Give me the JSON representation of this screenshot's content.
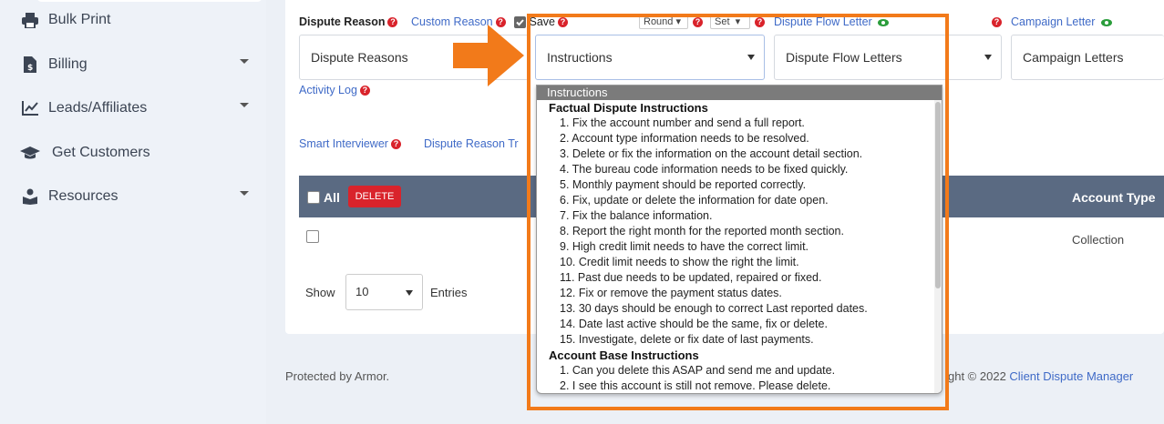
{
  "sidebar": {
    "items": [
      {
        "label": "Bulk Print",
        "icon": "printer-icon",
        "has_caret": false
      },
      {
        "label": "Billing",
        "icon": "invoice-icon",
        "has_caret": true
      },
      {
        "label": "Leads/Affiliates",
        "icon": "chart-line-icon",
        "has_caret": true
      },
      {
        "label": "Get Customers",
        "icon": "graduation-cap-icon",
        "has_caret": false
      },
      {
        "label": "Resources",
        "icon": "book-reader-icon",
        "has_caret": true
      }
    ]
  },
  "form": {
    "dispute_reason_label": "Dispute Reason",
    "custom_reason_link": "Custom Reason",
    "save_label": "Save",
    "round_value": "Round",
    "set_value": "Set",
    "dispute_flow_letter_link": "Dispute Flow Letter",
    "campaign_letter_link": "Campaign Letter",
    "dispute_reasons_select": "Dispute Reasons",
    "instructions_select": "Instructions",
    "dispute_flow_letters_select": "Dispute Flow Letters",
    "campaign_letters_select": "Campaign Letters",
    "activity_log_link": "Activity Log",
    "smart_interviewer_link": "Smart Interviewer",
    "dispute_reason_tr_link": "Dispute Reason Tr"
  },
  "table": {
    "all_label": "All",
    "delete_label": "DELETE",
    "account_type_header": "Account Type",
    "row_account_type": "Collection"
  },
  "pagination": {
    "show_label": "Show",
    "entries_value": "10",
    "entries_label": "Entries"
  },
  "footer": {
    "left": "Protected by Armor.",
    "right_prefix": "ght © 2022 ",
    "right_brand": "Client Dispute Manager"
  },
  "dropdown": {
    "selected": "Instructions",
    "groups": [
      {
        "label": "Factual Dispute Instructions",
        "options": [
          "1. Fix the account number and send a full report.",
          "2. Account type information needs to be resolved.",
          "3. Delete or fix the information on the account detail section.",
          "4. The bureau code information needs to be fixed quickly.",
          "5. Monthly payment should be reported correctly.",
          "6. Fix, update or delete the information for date open.",
          "7. Fix the balance information.",
          "8. Report the right month for the reported month section.",
          "9. High credit limit needs to have the correct limit.",
          "10. Credit limit needs to show the right the limit.",
          "11. Past due needs to be updated, repaired or fixed.",
          "12. Fix or remove the payment status dates.",
          "13. 30 days should be enough to correct Last reported dates.",
          "14. Date last active should be the same, fix or delete.",
          "15. Investigate, delete or fix date of last payments."
        ]
      },
      {
        "label": "Account Base Instructions",
        "options": [
          "1. Can you delete this ASAP and send me and update.",
          "2. I see this account is still not remove. Please delete."
        ]
      }
    ]
  },
  "colors": {
    "accent_orange": "#f27a1a",
    "link_blue": "#3f6ac7",
    "danger_red": "#d9232b",
    "table_header": "#5a6a82"
  }
}
